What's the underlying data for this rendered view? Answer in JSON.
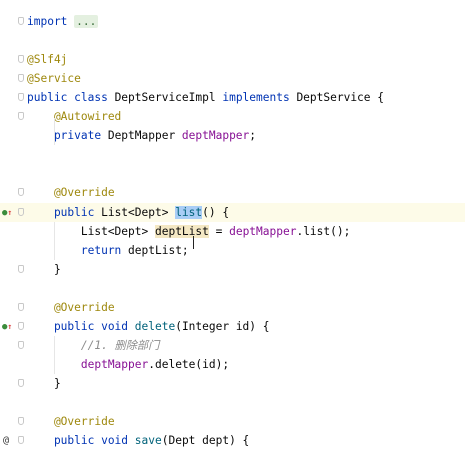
{
  "editor": {
    "lines": [
      {
        "tokens": [
          {
            "t": "import ",
            "c": "kw"
          },
          {
            "t": "...",
            "c": "folded"
          }
        ]
      },
      {
        "tokens": []
      },
      {
        "tokens": [
          {
            "t": "@Slf4j",
            "c": "ann"
          }
        ]
      },
      {
        "tokens": [
          {
            "t": "@Service",
            "c": "ann"
          }
        ]
      },
      {
        "tokens": [
          {
            "t": "public class ",
            "c": "kw"
          },
          {
            "t": "DeptServiceImpl ",
            "c": "id"
          },
          {
            "t": "implements ",
            "c": "kw"
          },
          {
            "t": "DeptService {",
            "c": "id"
          }
        ]
      },
      {
        "tokens": [
          {
            "t": "    @Autowired",
            "c": "ann"
          }
        ]
      },
      {
        "tokens": [
          {
            "t": "    private ",
            "c": "kw"
          },
          {
            "t": "DeptMapper ",
            "c": "id"
          },
          {
            "t": "deptMapper",
            "c": "fld"
          },
          {
            "t": ";",
            "c": "id"
          }
        ]
      },
      {
        "tokens": []
      },
      {
        "tokens": []
      },
      {
        "tokens": [
          {
            "t": "    @Override",
            "c": "ann"
          }
        ]
      },
      {
        "tokens": [
          {
            "t": "    public ",
            "c": "kw"
          },
          {
            "t": "List<Dept> ",
            "c": "id"
          },
          {
            "t": "list",
            "c": "mth sel"
          },
          {
            "t": "() {",
            "c": "id"
          }
        ]
      },
      {
        "tokens": [
          {
            "t": "        List<Dept> ",
            "c": "id"
          },
          {
            "t": "deptList",
            "c": "id usage"
          },
          {
            "t": " = ",
            "c": "id"
          },
          {
            "t": "deptMapper",
            "c": "fld"
          },
          {
            "t": ".list();",
            "c": "id"
          }
        ]
      },
      {
        "tokens": [
          {
            "t": "        return ",
            "c": "kw"
          },
          {
            "t": "deptList;",
            "c": "id"
          }
        ]
      },
      {
        "tokens": [
          {
            "t": "    }",
            "c": "id"
          }
        ]
      },
      {
        "tokens": []
      },
      {
        "tokens": [
          {
            "t": "    @Override",
            "c": "ann"
          }
        ]
      },
      {
        "tokens": [
          {
            "t": "    public void ",
            "c": "kw"
          },
          {
            "t": "delete",
            "c": "mth"
          },
          {
            "t": "(Integer id) {",
            "c": "id"
          }
        ]
      },
      {
        "tokens": [
          {
            "t": "        //1. 删除部门",
            "c": "cmt"
          }
        ]
      },
      {
        "tokens": [
          {
            "t": "        deptMapper",
            "c": "fld"
          },
          {
            "t": ".delete(id);",
            "c": "id"
          }
        ]
      },
      {
        "tokens": [
          {
            "t": "    }",
            "c": "id"
          }
        ]
      },
      {
        "tokens": []
      },
      {
        "tokens": [
          {
            "t": "    @Override",
            "c": "ann"
          }
        ]
      },
      {
        "tokens": [
          {
            "t": "    public void ",
            "c": "kw"
          },
          {
            "t": "save",
            "c": "mth"
          },
          {
            "t": "(Dept dept) {",
            "c": "id"
          }
        ]
      }
    ]
  },
  "gutter": {
    "override_icon": "override-implements-icon",
    "at_icon": "annotation-at-icon"
  },
  "colors": {
    "keyword": "#0033b3",
    "annotation": "#9e880d",
    "field": "#871094",
    "method": "#00627a",
    "selection": "#a9cdf5",
    "current_line": "#fdfbe8"
  }
}
